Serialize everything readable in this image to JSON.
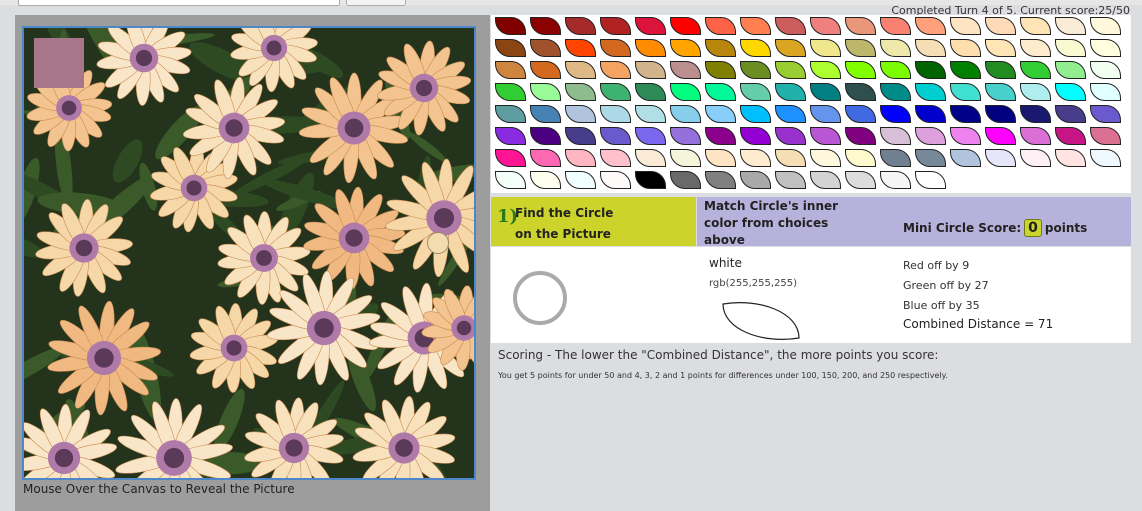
{
  "turn_status": "Completed Turn 4 of 5. Current score:25/50",
  "canvas": {
    "caption": "Mouse Over the Canvas to Reveal the Picture",
    "sample_swatch_color": "#a8768a",
    "target_circle_color": "#f3dcb0"
  },
  "palette": {
    "colors": [
      [
        "#800000",
        "#8b0000",
        "#a52a2a",
        "#b22222",
        "#dc143c",
        "#ff0000",
        "#ff6347",
        "#ff7f50",
        "#cd5c5c",
        "#f08080",
        "#e9967a",
        "#fa8072",
        "#ffa07a",
        "#ffe4c4",
        "#ffdab9",
        "#ffe4b5",
        "#faebd7",
        "#fff8dc"
      ],
      [
        "#8b4513",
        "#a0522d",
        "#ff4500",
        "#d2691e",
        "#ff8c00",
        "#ffa500",
        "#b8860b",
        "#ffd700",
        "#daa520",
        "#f0e68c",
        "#bdb76b",
        "#eee8aa",
        "#f5deb3",
        "#ffdead",
        "#ffe4b5",
        "#ffebcd",
        "#fafad2",
        "#ffffe0"
      ],
      [
        "#cd853f",
        "#d2691e",
        "#deb887",
        "#f4a460",
        "#d2b48c",
        "#bc8f8f",
        "#808000",
        "#6b8e23",
        "#9acd32",
        "#adff2f",
        "#7fff00",
        "#7cfc00",
        "#006400",
        "#008000",
        "#228b22",
        "#32cd32",
        "#90ee90",
        "#f0fff0"
      ],
      [
        "#32cd32",
        "#98fb98",
        "#8fbc8f",
        "#3cb371",
        "#2e8b57",
        "#00ff7f",
        "#00fa9a",
        "#66cdaa",
        "#20b2aa",
        "#008080",
        "#2f4f4f",
        "#008b8b",
        "#00ced1",
        "#40e0d0",
        "#48d1cc",
        "#afeeee",
        "#00ffff",
        "#e0ffff"
      ],
      [
        "#5f9ea0",
        "#4682b4",
        "#b0c4de",
        "#add8e6",
        "#b0e0e6",
        "#87ceeb",
        "#87cefa",
        "#00bfff",
        "#1e90ff",
        "#6495ed",
        "#4169e1",
        "#0000ff",
        "#0000cd",
        "#00008b",
        "#000080",
        "#191970",
        "#483d8b",
        "#6a5acd"
      ],
      [
        "#8a2be2",
        "#4b0082",
        "#483d8b",
        "#6a5acd",
        "#7b68ee",
        "#9370db",
        "#8b008b",
        "#9400d3",
        "#9932cc",
        "#ba55d3",
        "#800080",
        "#d8bfd8",
        "#dda0dd",
        "#ee82ee",
        "#ff00ff",
        "#da70d6",
        "#c71585",
        "#db7093"
      ],
      [
        "#ff1493",
        "#ff69b4",
        "#ffb6c1",
        "#ffc0cb",
        "#faebd7",
        "#f5f5dc",
        "#ffe4c4",
        "#ffebcd",
        "#f5deb3",
        "#fff8dc",
        "#fffacd",
        "#708090",
        "#778899",
        "#b0c4de",
        "#e6e6fa",
        "#fff0f5",
        "#ffe4e1",
        "#f0f8ff"
      ],
      [
        "#f5fffa",
        "#fffff0",
        "#f0ffff",
        "#fffafa",
        "#000000",
        "#696969",
        "#808080",
        "#a9a9a9",
        "#c0c0c0",
        "#d3d3d3",
        "#dcdcdc",
        "#f5f5f5",
        "#ffffff"
      ]
    ]
  },
  "steps": {
    "step1_number": "1)",
    "step1_line1": "Find the Circle",
    "step1_line2": "on the Picture",
    "step2_line1": "Match Circle's inner",
    "step2_line2": "color from choices",
    "step2_line3": "above",
    "mini_score_label": "Mini Circle Score:",
    "mini_score_value": "0",
    "mini_score_unit": "points"
  },
  "result": {
    "color_name": "white",
    "color_rgb": "rgb(255,255,255)",
    "ring_color": "#aaaaaa",
    "selected_color": "#ffffff",
    "red_off": "Red off by 9",
    "green_off": "Green off by 27",
    "blue_off": "Blue off by 35",
    "combined": "Combined Distance = 71"
  },
  "scoring": {
    "title": "Scoring - The lower the \"Combined Distance\", the more points you score:",
    "detail": "You get 5 points for under 50 and 4, 3, 2 and 1 points for differences under 100, 150, 200, and 250 respectively."
  }
}
